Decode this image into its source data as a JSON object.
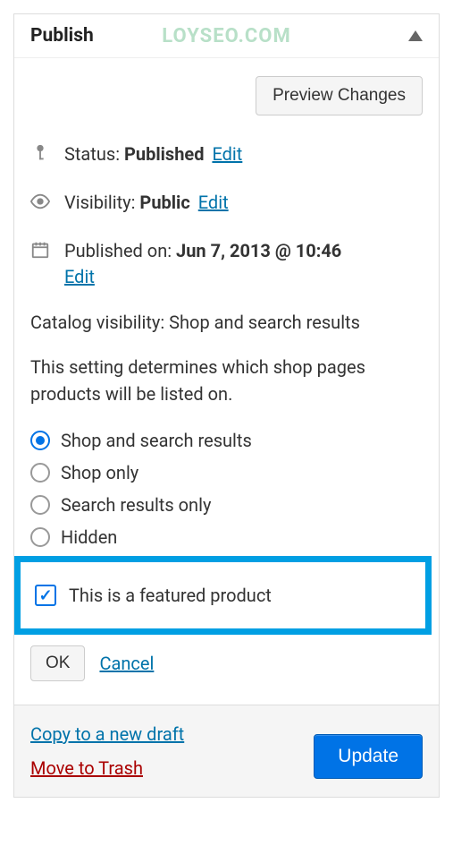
{
  "panel": {
    "title": "Publish",
    "watermark": "LOYSEO.COM",
    "preview_button": "Preview Changes"
  },
  "status": {
    "label": "Status: ",
    "value": "Published",
    "edit": "Edit"
  },
  "visibility": {
    "label": "Visibility: ",
    "value": "Public",
    "edit": "Edit"
  },
  "published": {
    "label": "Published on: ",
    "value": "Jun 7, 2013 @ 10:46",
    "edit": "Edit"
  },
  "catalog": {
    "heading_label": "Catalog visibility: ",
    "heading_value": "Shop and search results",
    "description": "This setting determines which shop pages products will be listed on.",
    "options": [
      "Shop and search results",
      "Shop only",
      "Search results only",
      "Hidden"
    ],
    "selected_index": 0,
    "featured_label": "This is a featured product",
    "featured_checked": true,
    "ok": "OK",
    "cancel": "Cancel"
  },
  "footer": {
    "copy": "Copy to a new draft",
    "trash": "Move to Trash",
    "update": "Update"
  }
}
